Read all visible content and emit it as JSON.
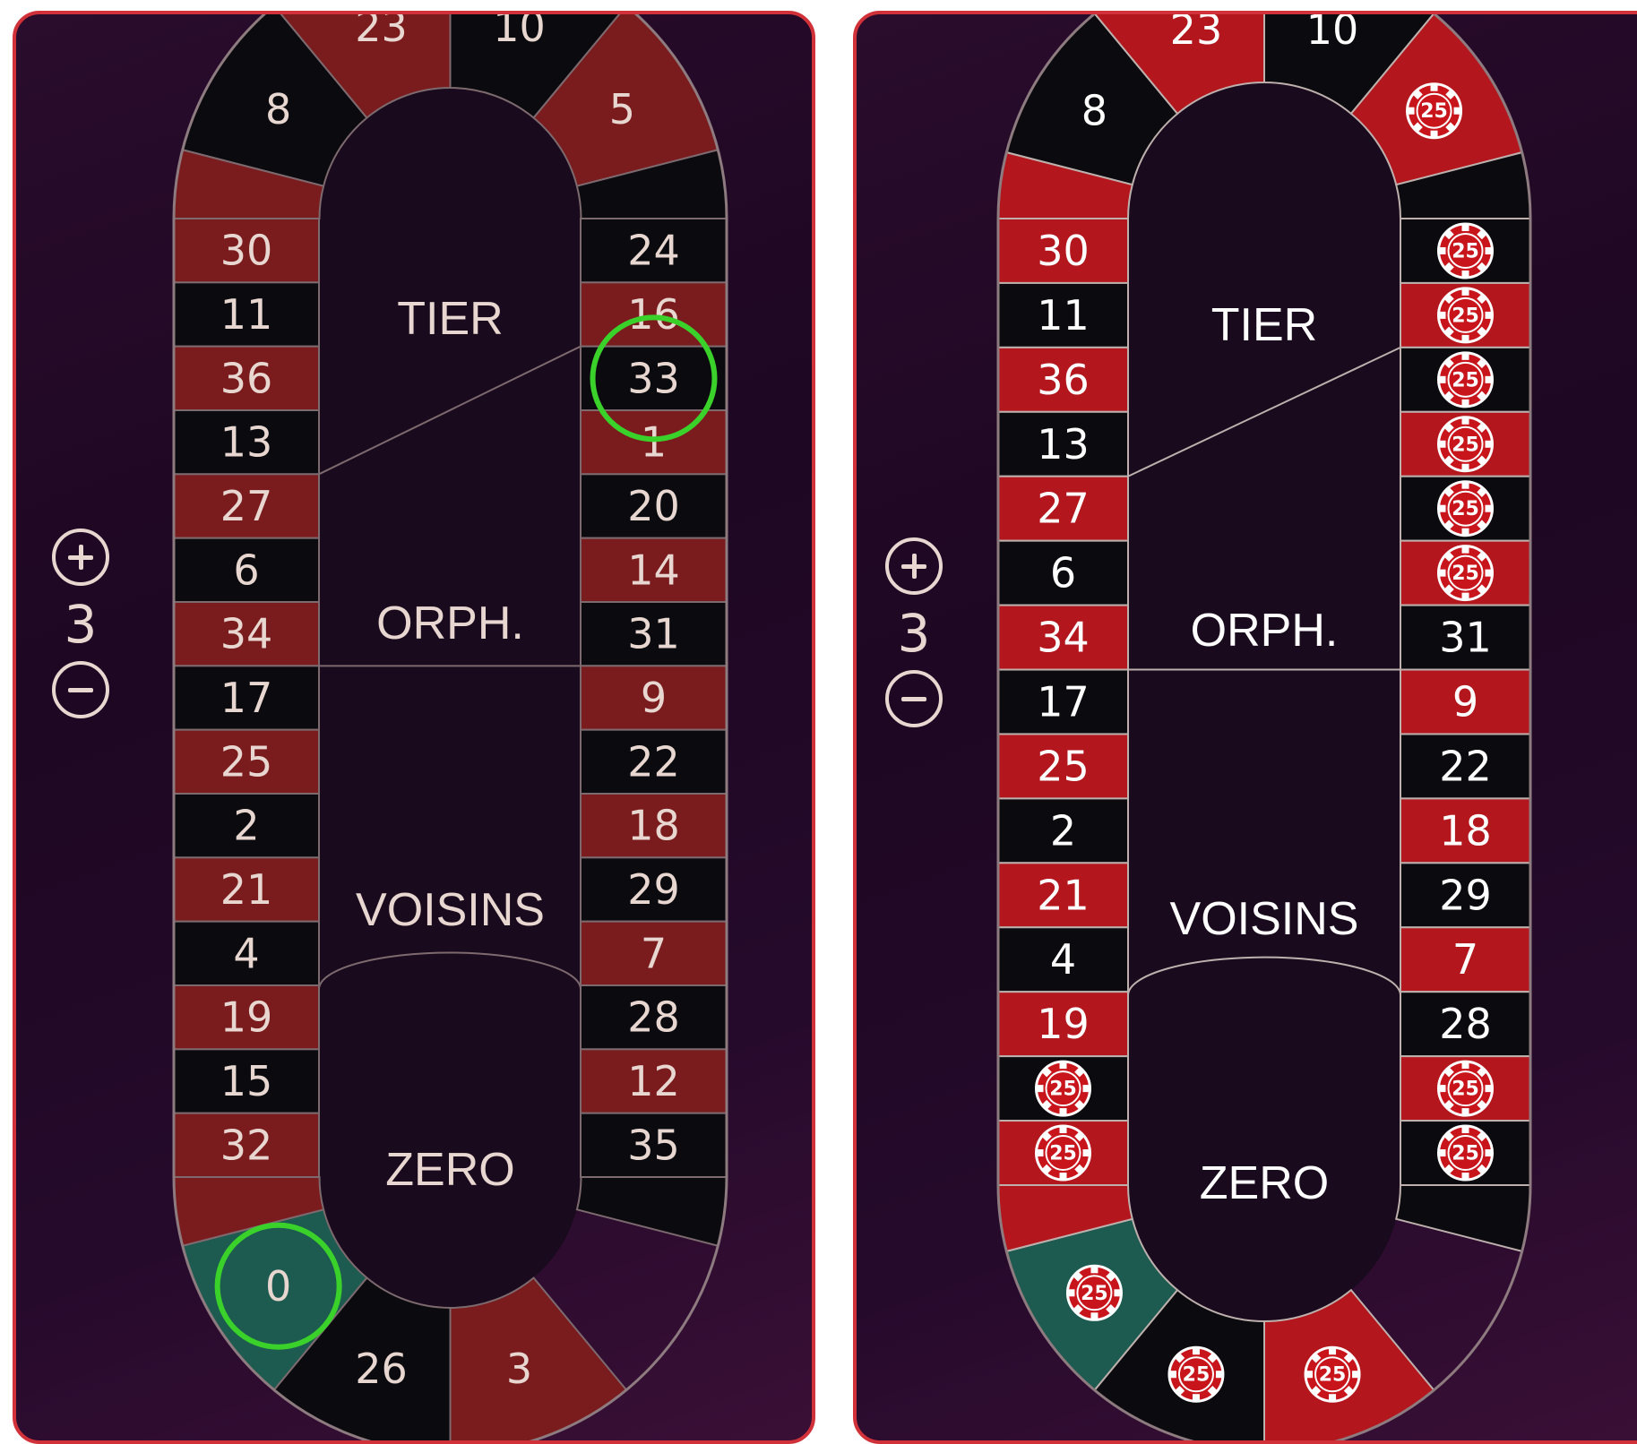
{
  "panels": [
    {
      "id": "panel-1",
      "neighbors": {
        "count": "3",
        "plus_icon": "plus-circle-icon",
        "minus_icon": "minus-circle-icon"
      },
      "sections": [
        "TIER",
        "ORPH.",
        "VOISINS",
        "ZERO"
      ],
      "top_numbers": [
        "8",
        "23",
        "10",
        "5"
      ],
      "left_column": [
        "30",
        "11",
        "36",
        "13",
        "27",
        "6",
        "34",
        "17",
        "25",
        "2",
        "21",
        "4",
        "19",
        "15",
        "32"
      ],
      "right_column": [
        "24",
        "16",
        "33",
        "1",
        "20",
        "14",
        "31",
        "9",
        "22",
        "18",
        "29",
        "7",
        "28",
        "12",
        "35"
      ],
      "bottom_numbers": [
        "0",
        "26",
        "3"
      ],
      "highlighted_numbers": [
        "33",
        "0"
      ],
      "chip_value": "25",
      "chips_on_numbers": []
    },
    {
      "id": "panel-2",
      "neighbors": {
        "count": "3",
        "plus_icon": "plus-circle-icon",
        "minus_icon": "minus-circle-icon"
      },
      "sections": [
        "TIER",
        "ORPH.",
        "VOISINS",
        "ZERO"
      ],
      "top_numbers": [
        "8",
        "23",
        "10",
        "5"
      ],
      "left_column": [
        "30",
        "11",
        "36",
        "13",
        "27",
        "6",
        "34",
        "17",
        "25",
        "2",
        "21",
        "4",
        "19",
        "15",
        "32"
      ],
      "right_column": [
        "24",
        "16",
        "33",
        "1",
        "20",
        "14",
        "31",
        "9",
        "22",
        "18",
        "29",
        "7",
        "28",
        "12",
        "35"
      ],
      "bottom_numbers": [
        "0",
        "26",
        "3"
      ],
      "highlighted_numbers": [],
      "chip_value": "25",
      "chips_on_numbers": [
        "5",
        "24",
        "16",
        "33",
        "1",
        "20",
        "14",
        "15",
        "32",
        "0",
        "26",
        "3",
        "35",
        "12"
      ]
    }
  ],
  "colors": {
    "red": "#7a1b1e",
    "red_bright": "#b3161c",
    "black": "#0b0b0f",
    "green": "#1d5a4f",
    "highlight": "#3ad12a",
    "text": "#e8d7d0",
    "text_white": "#ffffff",
    "frame": "#d1323a"
  }
}
